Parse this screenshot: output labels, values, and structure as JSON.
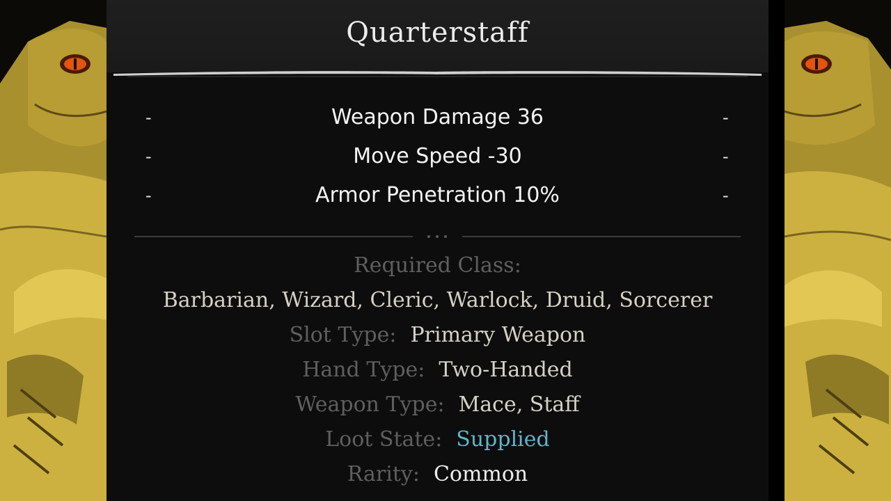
{
  "item": {
    "name": "Quarterstaff"
  },
  "stats": [
    {
      "text": "Weapon Damage 36",
      "left_marker": "-",
      "right_marker": "-"
    },
    {
      "text": "Move Speed -30",
      "left_marker": "-",
      "right_marker": "-"
    },
    {
      "text": "Armor Penetration 10%",
      "left_marker": "-",
      "right_marker": "-"
    }
  ],
  "info": {
    "required_class_label": "Required Class:",
    "required_class_value": "Barbarian, Wizard, Cleric, Warlock, Druid, Sorcerer",
    "slot_type_label": "Slot Type:",
    "slot_type_value": "Primary Weapon",
    "hand_type_label": "Hand Type:",
    "hand_type_value": "Two-Handed",
    "weapon_type_label": "Weapon Type:",
    "weapon_type_value": "Mace, Staff",
    "loot_state_label": "Loot State:",
    "loot_state_value": "Supplied",
    "rarity_label": "Rarity:",
    "rarity_value": "Common"
  },
  "colors": {
    "panel_bg": "#0d0d0d",
    "title_bar_bg": "#1c1c1c",
    "label_gray": "#5f5f5f",
    "value_beige": "#d6d1c6",
    "loot_state_cyan": "#5fb6c8",
    "character_skin": "#c9ad3e"
  },
  "decor": {
    "side_art_icon": "lizard-character-art",
    "divider_icon": "ornament-dots-icon"
  }
}
